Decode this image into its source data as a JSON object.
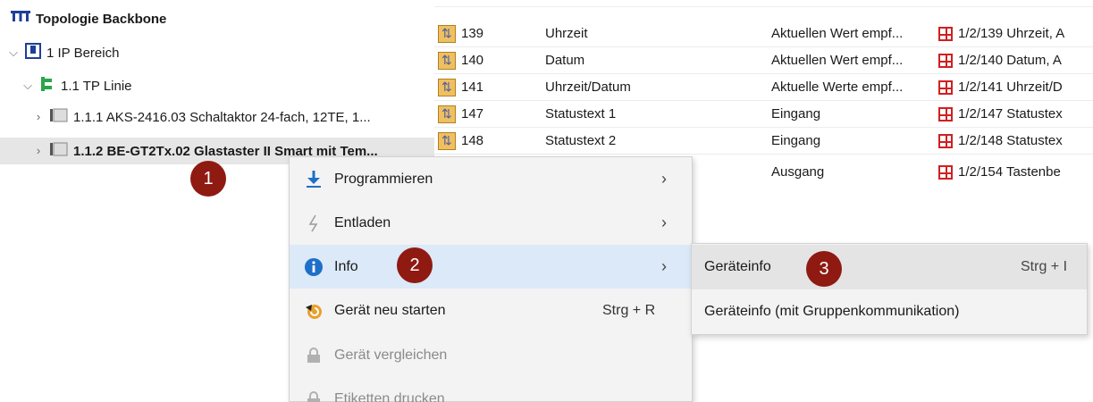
{
  "tree": {
    "root": "Topologie Backbone",
    "area": "1 IP Bereich",
    "line": "1.1 TP Linie",
    "dev1": "1.1.1 AKS-2416.03 Schaltaktor 24-fach, 12TE, 1...",
    "dev2": "1.1.2 BE-GT2Tx.02 Glastaster II Smart mit Tem..."
  },
  "table": {
    "rows": [
      {
        "num": "139",
        "name": "Uhrzeit",
        "func": "Aktuellen Wert empf...",
        "ga": "1/2/139 Uhrzeit, A"
      },
      {
        "num": "140",
        "name": "Datum",
        "func": "Aktuellen Wert empf...",
        "ga": "1/2/140 Datum, A"
      },
      {
        "num": "141",
        "name": "Uhrzeit/Datum",
        "func": "Aktuelle Werte empf...",
        "ga": "1/2/141 Uhrzeit/D"
      },
      {
        "num": "147",
        "name": "Statustext 1",
        "func": "Eingang",
        "ga": "1/2/147 Statustex"
      },
      {
        "num": "148",
        "name": "Statustext 2",
        "func": "Eingang",
        "ga": "1/2/148 Statustex"
      },
      {
        "num": "",
        "name": "",
        "func": "Ausgang",
        "ga": "1/2/154 Tastenbe"
      }
    ]
  },
  "menu": {
    "items": [
      {
        "label": "Programmieren",
        "shortcut": "",
        "icon": "download-arrow-icon"
      },
      {
        "label": "Entladen",
        "shortcut": "",
        "icon": "lightning-icon"
      },
      {
        "label": "Info",
        "shortcut": "",
        "icon": "info-icon"
      },
      {
        "label": "Gerät neu starten",
        "shortcut": "Strg + R",
        "icon": "restart-icon"
      },
      {
        "label": "Gerät vergleichen",
        "shortcut": "",
        "icon": "lock-icon"
      },
      {
        "label": "Etiketten drucken",
        "shortcut": "",
        "icon": "lock-icon"
      }
    ]
  },
  "submenu": {
    "items": [
      {
        "label": "Geräteinfo",
        "shortcut": "Strg + I"
      },
      {
        "label": "Geräteinfo (mit Gruppenkommunikation)",
        "shortcut": ""
      }
    ]
  },
  "badges": [
    "1",
    "2",
    "3"
  ],
  "colors": {
    "badge": "#8f1a12",
    "hover": "#dbe9f8",
    "ga_icon": "#d02020",
    "accent_blue": "#1e6fc8",
    "line_green": "#2aa64a"
  }
}
